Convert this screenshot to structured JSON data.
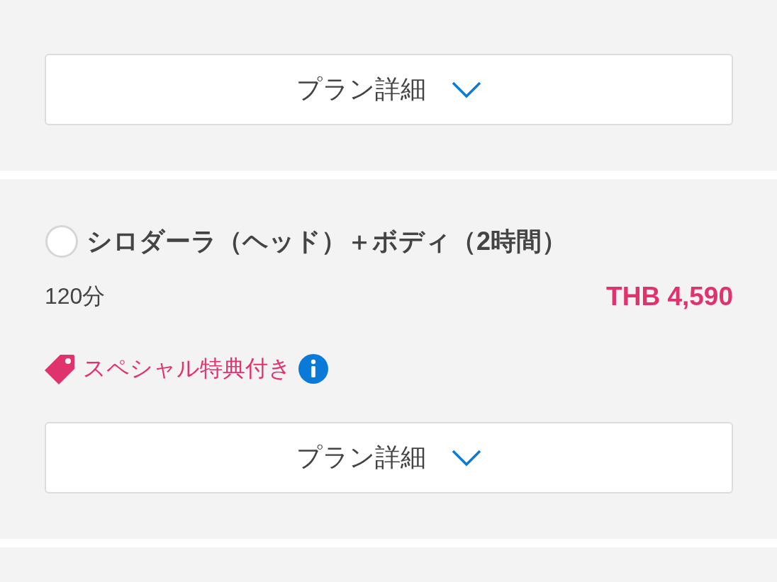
{
  "plans": [
    {
      "details_button": "プラン詳細"
    },
    {
      "selected": false,
      "name": "シロダーラ（ヘッド）＋ボディ（2時間）",
      "duration": "120分",
      "price": "THB 4,590",
      "perk": {
        "label": "スペシャル特典付き"
      },
      "details_button": "プラン詳細"
    }
  ]
}
